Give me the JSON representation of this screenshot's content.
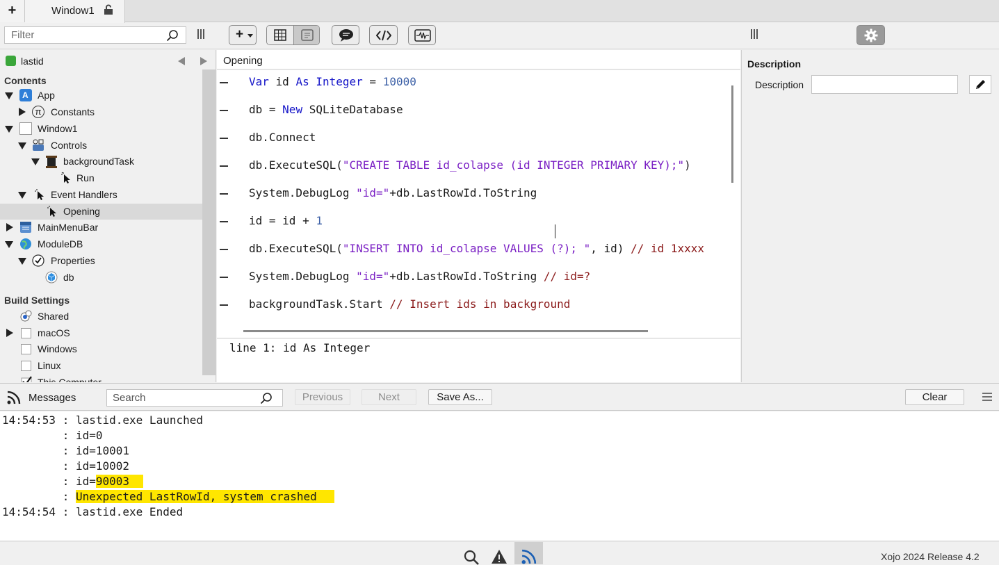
{
  "tabs": {
    "add_label": "+",
    "window_tab_label": "Window1"
  },
  "toolbar": {
    "filter_placeholder": "Filter",
    "add_button_label": "+"
  },
  "navigator": {
    "project_name": "lastid",
    "contents_title": "Contents",
    "items": [
      {
        "label": "App"
      },
      {
        "label": "Constants"
      },
      {
        "label": "Window1"
      },
      {
        "label": "Controls"
      },
      {
        "label": "backgroundTask"
      },
      {
        "label": "Run"
      },
      {
        "label": "Event Handlers"
      },
      {
        "label": "Opening"
      },
      {
        "label": "MainMenuBar"
      },
      {
        "label": "ModuleDB"
      },
      {
        "label": "Properties"
      },
      {
        "label": "db"
      }
    ],
    "build_settings_title": "Build Settings",
    "build_items": [
      {
        "label": "Shared"
      },
      {
        "label": "macOS"
      },
      {
        "label": "Windows"
      },
      {
        "label": "Linux"
      },
      {
        "label": "This Computer"
      }
    ]
  },
  "editor": {
    "method_name": "Opening",
    "code_lines": [
      [
        {
          "t": "Var",
          "c": "kw"
        },
        {
          "t": " id "
        },
        {
          "t": "As",
          "c": "kw"
        },
        {
          "t": " "
        },
        {
          "t": "Integer",
          "c": "kw"
        },
        {
          "t": " = "
        },
        {
          "t": "10000",
          "c": "num"
        }
      ],
      [
        {
          "t": "db = "
        },
        {
          "t": "New",
          "c": "kw"
        },
        {
          "t": " SQLiteDatabase"
        }
      ],
      [
        {
          "t": "db.Connect"
        }
      ],
      [
        {
          "t": "db.ExecuteSQL("
        },
        {
          "t": "\"CREATE TABLE id_colapse (id INTEGER PRIMARY KEY);\"",
          "c": "str"
        },
        {
          "t": ")"
        }
      ],
      [
        {
          "t": "System.DebugLog "
        },
        {
          "t": "\"id=\"",
          "c": "str"
        },
        {
          "t": "+db.LastRowId.ToString"
        }
      ],
      [
        {
          "t": "id = id + "
        },
        {
          "t": "1",
          "c": "num"
        }
      ],
      [
        {
          "t": "db.ExecuteSQL("
        },
        {
          "t": "\"INSERT INTO id_colapse VALUES (?); \"",
          "c": "str"
        },
        {
          "t": ", id) "
        },
        {
          "t": "// id 1xxxx",
          "c": "cmt"
        }
      ],
      [
        {
          "t": "System.DebugLog "
        },
        {
          "t": "\"id=\"",
          "c": "str"
        },
        {
          "t": "+db.LastRowId.ToString "
        },
        {
          "t": "// id=?",
          "c": "cmt"
        }
      ],
      [
        {
          "t": "backgroundTask.Start "
        },
        {
          "t": "// Insert ids in background",
          "c": "cmt"
        }
      ]
    ],
    "tip_text": "line 1: id As Integer"
  },
  "inspector": {
    "section_title": "Description",
    "field_label": "Description",
    "field_value": ""
  },
  "messages": {
    "title": "Messages",
    "search_placeholder": "Search",
    "previous_label": "Previous",
    "next_label": "Next",
    "save_as_label": "Save As...",
    "clear_label": "Clear",
    "log": [
      {
        "prefix": "14:54:53 : ",
        "text": "lastid.exe Launched",
        "highlight": ""
      },
      {
        "prefix": "         : ",
        "text": "id=0",
        "highlight": ""
      },
      {
        "prefix": "         : ",
        "text": "id=10001",
        "highlight": ""
      },
      {
        "prefix": "         : ",
        "text": "id=10002",
        "highlight": ""
      },
      {
        "prefix": "         : id=",
        "text": "90003",
        "highlight": "yes"
      },
      {
        "prefix": "         : ",
        "text": "Unexpected LastRowId, system crashed ",
        "highlight": "yes"
      },
      {
        "prefix": "14:54:54 : ",
        "text": "lastid.exe Ended",
        "highlight": ""
      }
    ]
  },
  "status": {
    "version": "Xojo 2024 Release 4.2"
  }
}
